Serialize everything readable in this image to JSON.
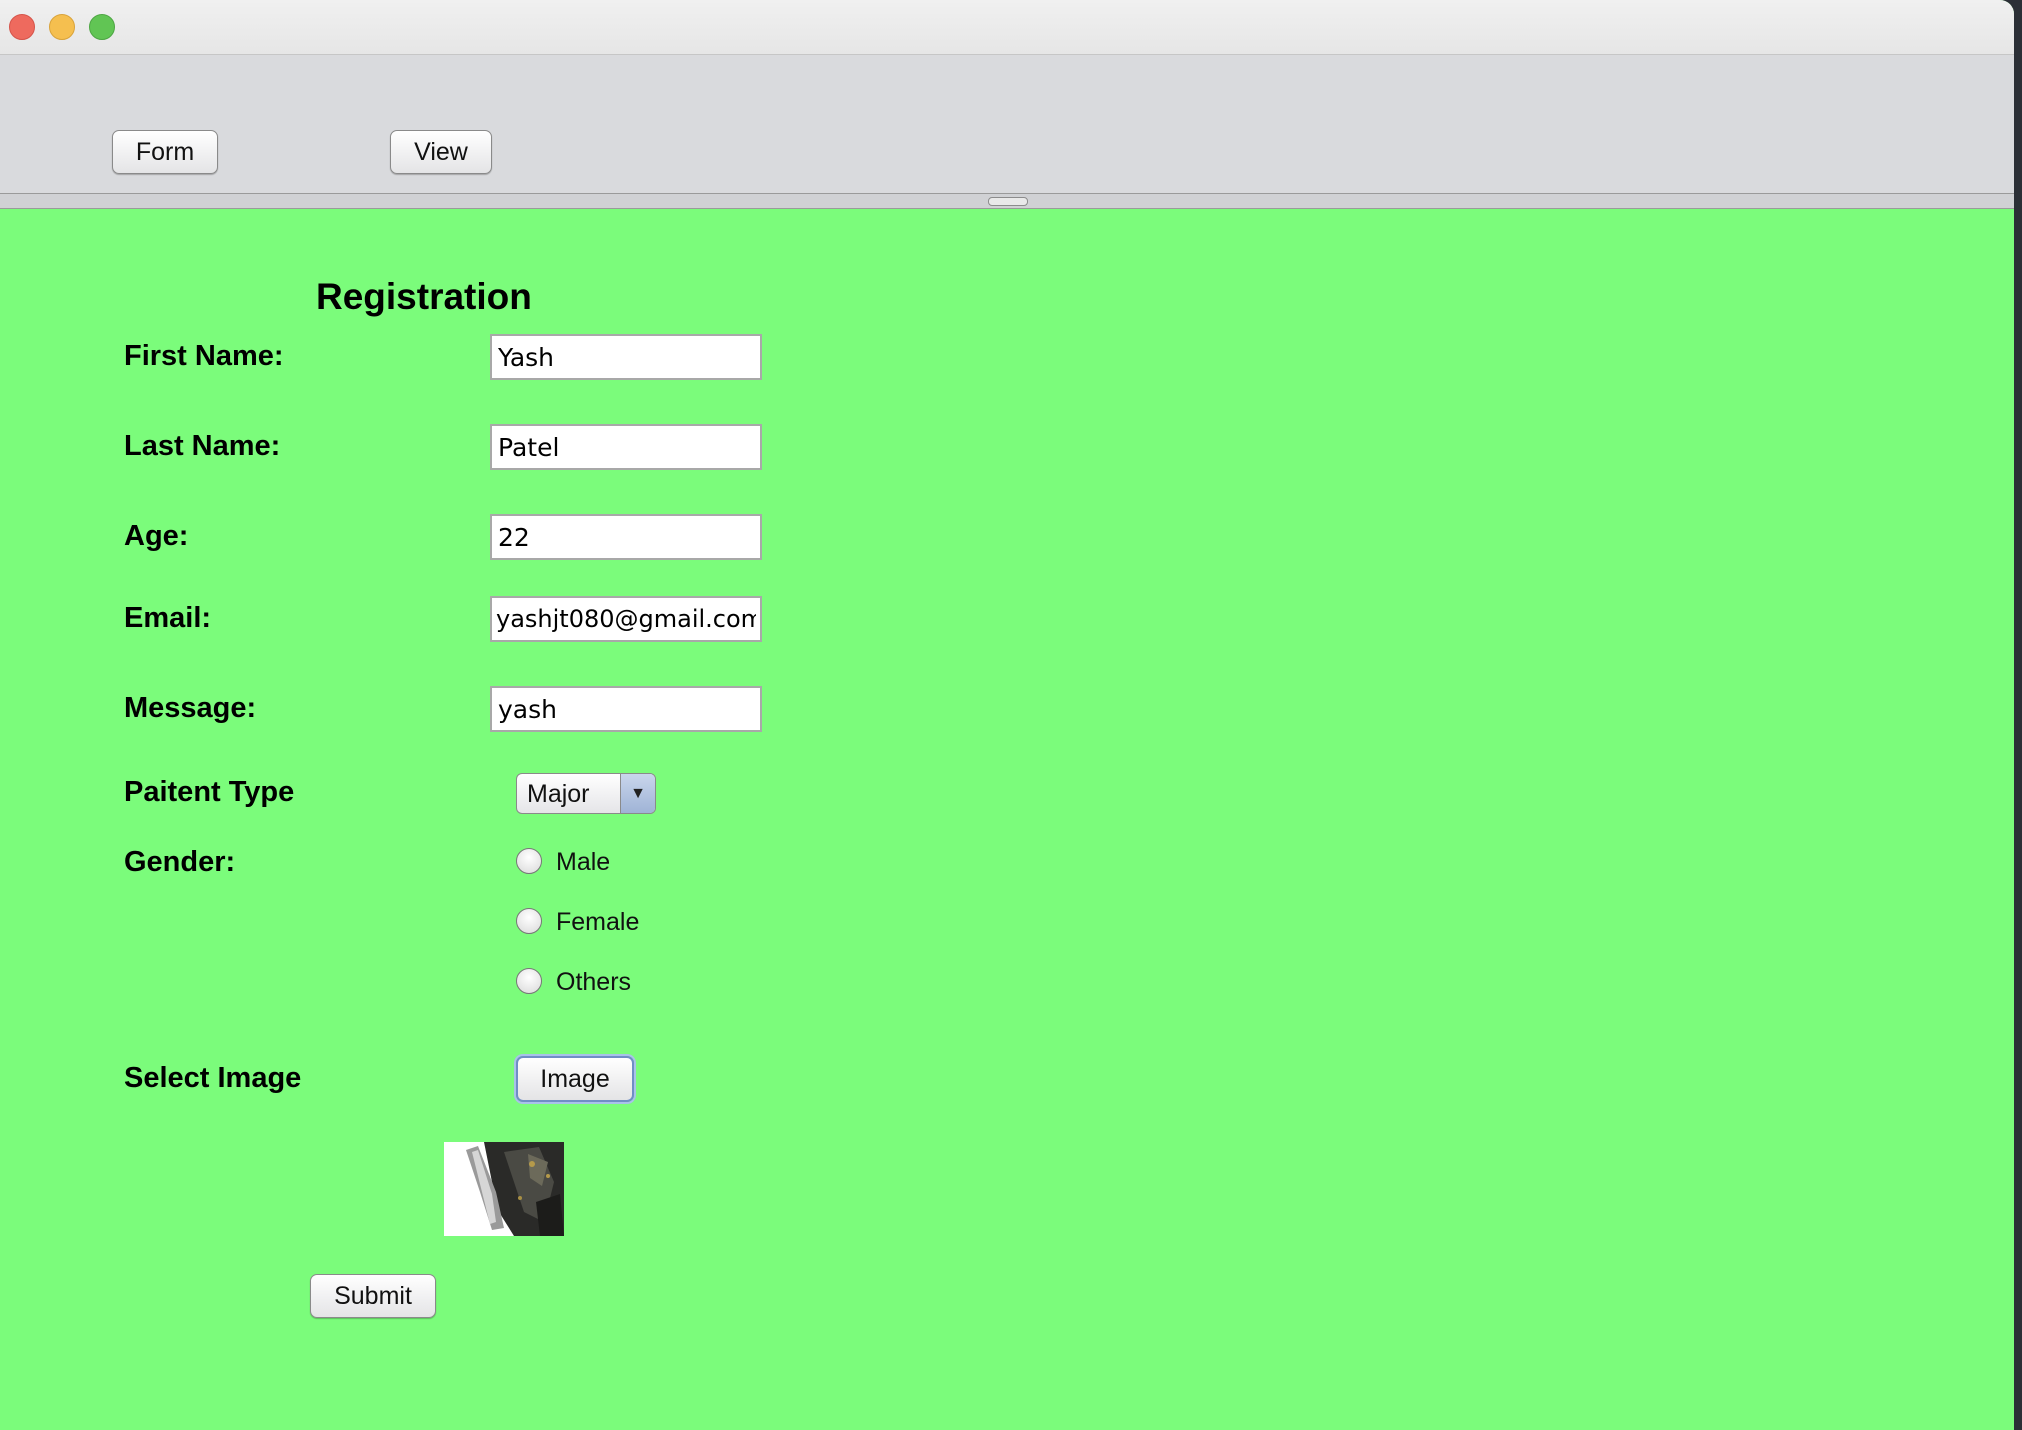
{
  "toolbar": {
    "form_label": "Form",
    "view_label": "View"
  },
  "form": {
    "title": "Registration",
    "first_name_label": "First Name:",
    "first_name_value": "Yash",
    "last_name_label": "Last Name:",
    "last_name_value": "Patel",
    "age_label": "Age:",
    "age_value": "22",
    "email_label": "Email:",
    "email_value": "yashjt080@gmail.com",
    "message_label": "Message:",
    "message_value": "yash",
    "patient_type_label": "Paitent Type",
    "patient_type_selected": "Major",
    "gender_label": "Gender:",
    "gender_options": [
      "Male",
      "Female",
      "Others"
    ],
    "select_image_label": "Select Image",
    "image_button_label": "Image",
    "submit_label": "Submit"
  },
  "colors": {
    "form_background": "#7bfc7b",
    "toolbar_background": "#d9dadd"
  }
}
